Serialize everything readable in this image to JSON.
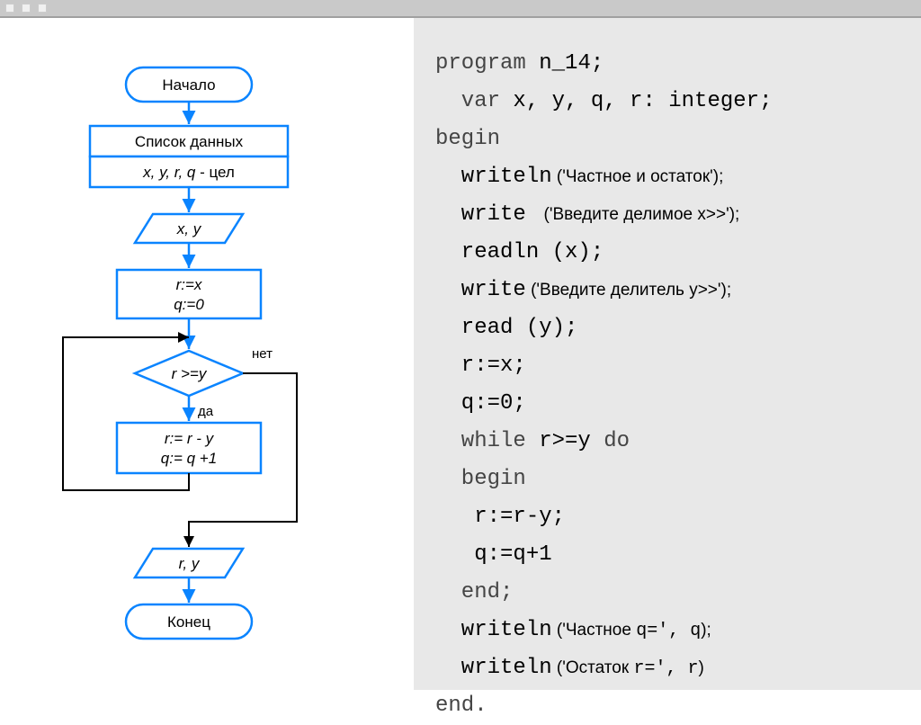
{
  "flow": {
    "start": "Начало",
    "data_header": "Список данных",
    "data_vars_prefix": "x, y, r, q",
    "data_vars_suffix": " - цел",
    "input": "x, y",
    "init1": "r:=x",
    "init2": "q:=0",
    "cond": "r >=y",
    "cond_no": "нет",
    "cond_yes": "да",
    "body1": "r:= r - y",
    "body2": "q:= q +1",
    "output": "r, y",
    "end": "Конец"
  },
  "code": {
    "l1_a": "program",
    "l1_b": " n_14;",
    "l2_a": "  var",
    "l2_b": " x, y, q, r: integer;",
    "l3": "begin",
    "l4_a": "  writeln",
    "l4_b": " ('Частное и остаток');",
    "l5_a": "  write ",
    "l5_b": " ('Введите делимое x>>');",
    "l6": "  readln (x);",
    "l7_a": "  write",
    "l7_b": " ('Введите делитель y>>');",
    "l8": "  read (y);",
    "l9": "  r:=x;",
    "l10": "  q:=0;",
    "l11_a": "  while ",
    "l11_b": "r>=y ",
    "l11_c": "do",
    "l12": "  begin",
    "l13": "   r:=r-y;",
    "l14": "   q:=q+1",
    "l15": "  end;",
    "l16_a": "  writeln",
    "l16_b": " ('Частное ",
    "l16_c": "q=', q",
    "l16_d": ");",
    "l17_a": "  writeln",
    "l17_b": " ('Остаток ",
    "l17_c": "r=', r",
    "l17_d": ")",
    "l18": "end."
  }
}
